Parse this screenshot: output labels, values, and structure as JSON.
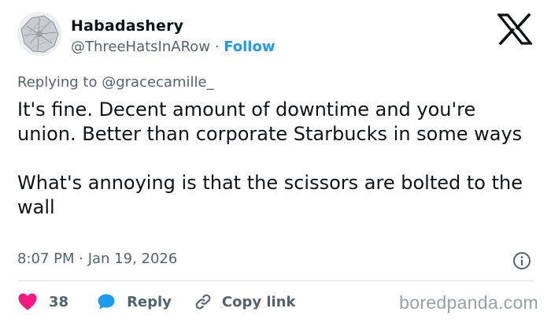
{
  "author": {
    "name": "Habadashery",
    "handle": "@ThreeHatsInARow",
    "separator": " · ",
    "follow_label": "Follow"
  },
  "reply_context": {
    "prefix": "Replying to ",
    "mention": "@gracecamille_"
  },
  "tweet": {
    "text": "It's fine. Decent amount of downtime and you're union. Better than corporate Starbucks in some ways\n\nWhat's annoying is that the scissors are bolted to the wall",
    "timestamp": "8:07 PM · Jan 19, 2026"
  },
  "actions": {
    "like_count": "38",
    "reply_label": "Reply",
    "copy_link_label": "Copy link"
  },
  "watermark": "boredpanda.com",
  "icons": {
    "logo": "x-logo-icon",
    "info": "info-icon",
    "like": "heart-icon",
    "reply": "speech-bubble-icon",
    "copy": "link-icon"
  },
  "colors": {
    "text": "#0f1419",
    "secondary": "#536471",
    "accent": "#1d9bf0",
    "like": "#f91880"
  }
}
